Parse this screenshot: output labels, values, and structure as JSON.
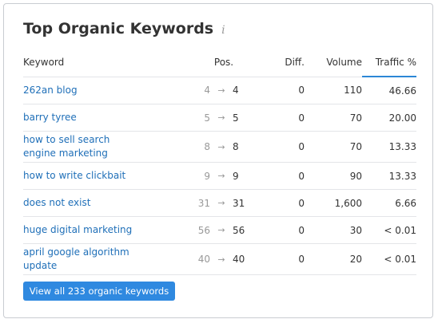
{
  "widget": {
    "title": "Top Organic Keywords",
    "info_icon": "i",
    "accent_color": "#2c87d6",
    "link_color": "#1f6fb8"
  },
  "table": {
    "headers": {
      "keyword": "Keyword",
      "pos": "Pos.",
      "diff": "Diff.",
      "volume": "Volume",
      "traffic": "Traffic %"
    },
    "arrow": "→",
    "rows": [
      {
        "keyword": "262an blog",
        "prev_pos": "4",
        "pos": "4",
        "diff": "0",
        "volume": "110",
        "traffic": "46.66"
      },
      {
        "keyword": "barry tyree",
        "prev_pos": "5",
        "pos": "5",
        "diff": "0",
        "volume": "70",
        "traffic": "20.00"
      },
      {
        "keyword": "how to sell search engine marketing",
        "prev_pos": "8",
        "pos": "8",
        "diff": "0",
        "volume": "70",
        "traffic": "13.33"
      },
      {
        "keyword": "how to write clickbait",
        "prev_pos": "9",
        "pos": "9",
        "diff": "0",
        "volume": "90",
        "traffic": "13.33"
      },
      {
        "keyword": "does not exist",
        "prev_pos": "31",
        "pos": "31",
        "diff": "0",
        "volume": "1,600",
        "traffic": "6.66"
      },
      {
        "keyword": "huge digital marketing",
        "prev_pos": "56",
        "pos": "56",
        "diff": "0",
        "volume": "30",
        "traffic": "< 0.01"
      },
      {
        "keyword": "april google algorithm update",
        "prev_pos": "40",
        "pos": "40",
        "diff": "0",
        "volume": "20",
        "traffic": "< 0.01"
      }
    ]
  },
  "footer": {
    "button_label": "View all 233 organic keywords"
  }
}
